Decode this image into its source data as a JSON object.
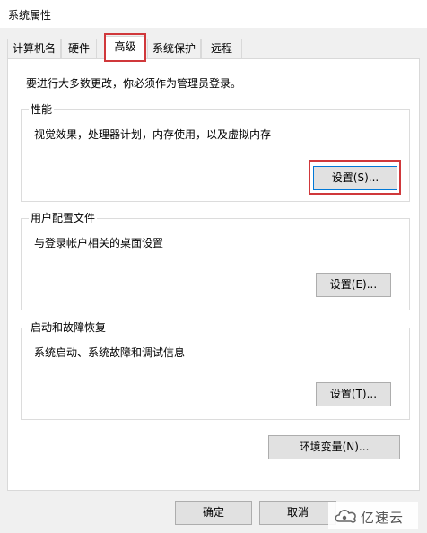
{
  "window": {
    "title": "系统属性"
  },
  "tabs": [
    {
      "label": "计算机名"
    },
    {
      "label": "硬件"
    },
    {
      "label": "高级",
      "active": true
    },
    {
      "label": "系统保护"
    },
    {
      "label": "远程"
    }
  ],
  "intro": "要进行大多数更改，你必须作为管理员登录。",
  "performance": {
    "title": "性能",
    "description": "视觉效果，处理器计划，内存使用，以及虚拟内存",
    "button": "设置(S)..."
  },
  "user_profiles": {
    "title": "用户配置文件",
    "description": "与登录帐户相关的桌面设置",
    "button": "设置(E)..."
  },
  "startup_recovery": {
    "title": "启动和故障恢复",
    "description": "系统启动、系统故障和调试信息",
    "button": "设置(T)..."
  },
  "env_button": "环境变量(N)...",
  "footer": {
    "ok": "确定",
    "cancel": "取消"
  },
  "watermark": {
    "text": "亿速云"
  },
  "colors": {
    "highlight": "#d0383b",
    "focus_border": "#0078d7",
    "button_bg": "#e1e1e1"
  }
}
